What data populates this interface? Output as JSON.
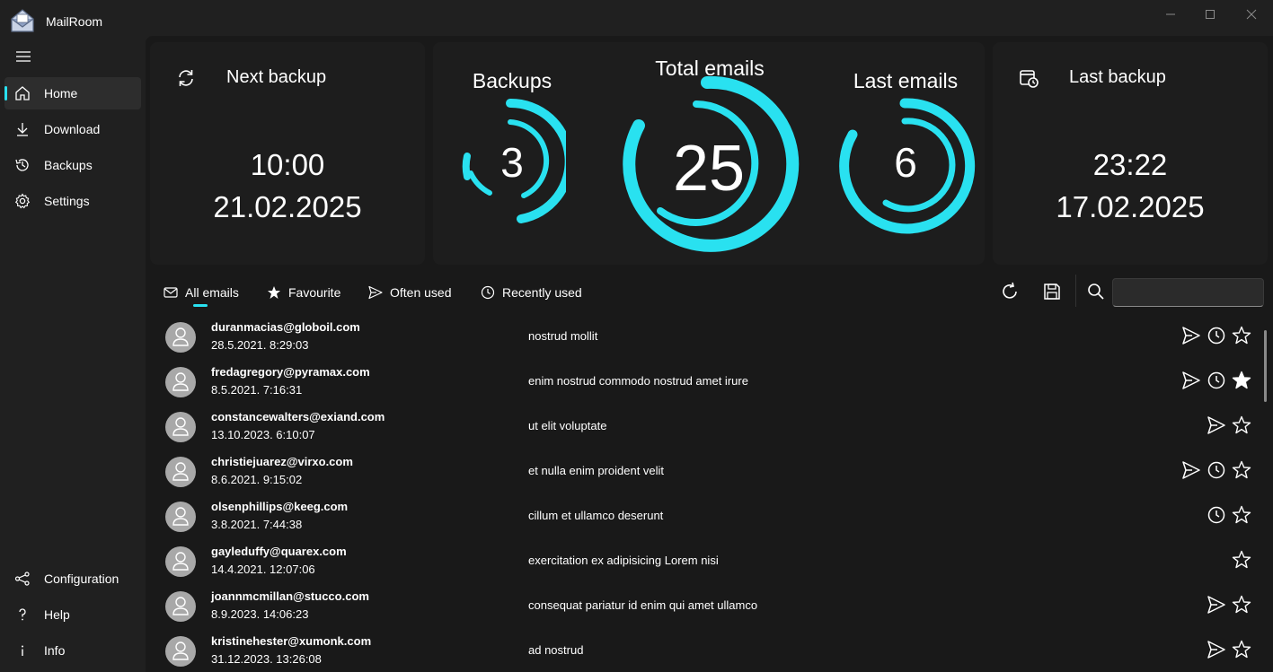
{
  "app": {
    "title": "MailRoom"
  },
  "sidebar": {
    "items": [
      {
        "label": "Home",
        "icon": "home-icon",
        "active": true
      },
      {
        "label": "Download",
        "icon": "download-icon"
      },
      {
        "label": "Backups",
        "icon": "history-icon"
      },
      {
        "label": "Settings",
        "icon": "gear-icon"
      }
    ],
    "footer_items": [
      {
        "label": "Configuration",
        "icon": "share-nodes-icon"
      },
      {
        "label": "Help",
        "icon": "question-icon"
      },
      {
        "label": "Info",
        "icon": "info-icon"
      }
    ]
  },
  "dashboard": {
    "next_backup": {
      "title": "Next backup",
      "time": "10:00",
      "date": "21.02.2025"
    },
    "backups": {
      "title": "Backups",
      "value": "3"
    },
    "total_emails": {
      "title": "Total emails",
      "value": "25"
    },
    "last_emails": {
      "title": "Last emails",
      "value": "6"
    },
    "last_backup": {
      "title": "Last backup",
      "time": "23:22",
      "date": "17.02.2025"
    }
  },
  "tabs": [
    {
      "label": "All emails",
      "icon": "mail-icon",
      "active": true
    },
    {
      "label": "Favourite",
      "icon": "star-filled-icon"
    },
    {
      "label": "Often used",
      "icon": "send-icon"
    },
    {
      "label": "Recently used",
      "icon": "clock-icon"
    }
  ],
  "toolbar": {
    "refresh_icon": "refresh-icon",
    "save_icon": "save-icon",
    "search_icon": "search-icon",
    "search_value": ""
  },
  "emails": [
    {
      "address": "duranmacias@globoil.com",
      "date": "28.5.2021. 8:29:03",
      "subject": "nostrud mollit",
      "sent": true,
      "recent": true,
      "favourite": false
    },
    {
      "address": "fredagregory@pyramax.com",
      "date": "8.5.2021. 7:16:31",
      "subject": "enim nostrud commodo nostrud amet irure",
      "sent": true,
      "recent": true,
      "favourite": true
    },
    {
      "address": "constancewalters@exiand.com",
      "date": "13.10.2023. 6:10:07",
      "subject": "ut elit voluptate",
      "sent": true,
      "recent": false,
      "favourite": false
    },
    {
      "address": "christiejuarez@virxo.com",
      "date": "8.6.2021. 9:15:02",
      "subject": "et nulla enim proident velit",
      "sent": true,
      "recent": true,
      "favourite": false
    },
    {
      "address": "olsenphillips@keeg.com",
      "date": "3.8.2021. 7:44:38",
      "subject": "cillum et ullamco deserunt",
      "sent": false,
      "recent": true,
      "favourite": false
    },
    {
      "address": "gayleduffy@quarex.com",
      "date": "14.4.2021. 12:07:06",
      "subject": "exercitation ex adipisicing Lorem nisi",
      "sent": false,
      "recent": false,
      "favourite": false
    },
    {
      "address": "joannmcmillan@stucco.com",
      "date": "8.9.2023. 14:06:23",
      "subject": "consequat pariatur id enim qui amet ullamco",
      "sent": true,
      "recent": false,
      "favourite": false
    },
    {
      "address": "kristinehester@xumonk.com",
      "date": "31.12.2023. 13:26:08",
      "subject": "ad nostrud",
      "sent": true,
      "recent": false,
      "favourite": false
    }
  ],
  "colors": {
    "accent": "#29e1f0",
    "background": "#202020",
    "surface": "#1d1d1d",
    "avatar": "#a8a8a8"
  }
}
